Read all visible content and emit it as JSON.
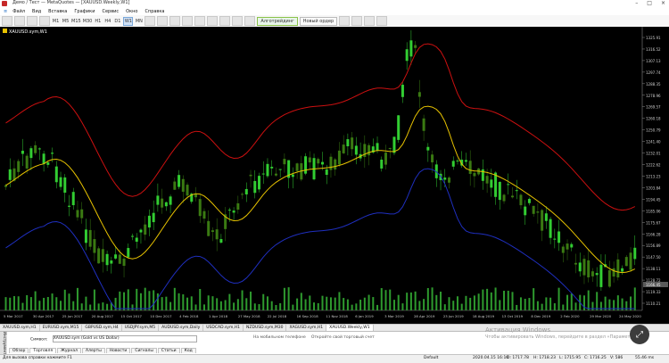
{
  "window": {
    "title": "Демо / Тест — MetaQuotes — [XAUUSD.Weekly,W1]"
  },
  "menu": {
    "items": [
      "Файл",
      "Вид",
      "Вставка",
      "Графики",
      "Сервис",
      "Окно",
      "Справка"
    ]
  },
  "toolbar": {
    "timeframes": [
      "M1",
      "M5",
      "M15",
      "M30",
      "H1",
      "H4",
      "D1",
      "W1",
      "MN"
    ],
    "active_timeframe": "W1",
    "algo_label": "Алготрейдинг",
    "new_order_label": "Новый ордер"
  },
  "chart": {
    "symbol_label": "XAUUSD.sym,W1",
    "price_labels": [
      "1325.91",
      "1316.52",
      "1307.13",
      "1297.74",
      "1288.35",
      "1278.96",
      "1269.57",
      "1260.18",
      "1250.79",
      "1241.40",
      "1232.01",
      "1222.62",
      "1213.23",
      "1203.84",
      "1194.45",
      "1185.06",
      "1175.67",
      "1166.28",
      "1156.89",
      "1147.50",
      "1138.11",
      "1128.72",
      "1119.33",
      "1110.21"
    ],
    "current_price": "1166.45",
    "time_labels": [
      "5 Mar 2017",
      "30 Apr 2017",
      "25 Jun 2017",
      "20 Aug 2017",
      "15 Oct 2017",
      "10 Dec 2017",
      "4 Feb 2018",
      "1 Apr 2018",
      "27 May 2018",
      "22 Jul 2018",
      "16 Sep 2018",
      "11 Nov 2018",
      "6 Jan 2019",
      "3 Mar 2019",
      "28 Apr 2019",
      "23 Jun 2019",
      "18 Aug 2019",
      "13 Oct 2019",
      "8 Dec 2019",
      "2 Feb 2020",
      "29 Mar 2020",
      "24 May 2020"
    ],
    "colors": {
      "background": "#000000",
      "bull": "#32cd32",
      "bear": "#3a7a12",
      "upper_band": "#cc1010",
      "middle_band": "#e8c300",
      "lower_band": "#1f2fbf",
      "volume": "#2e9a2e"
    }
  },
  "chart_tabs": [
    "XAUUSD.sym,H1",
    "EURUSD.sym,M15",
    "GBPUSD.sym,H4",
    "USDJPY.sym,M5",
    "AUDUSD.sym,Daily",
    "USDCAD.sym,H1",
    "NZDUSD.sym,M30",
    "XAGUSD.sym,H1",
    "XAUUSD.Weekly,W1"
  ],
  "active_chart_tab": "XAUUSD.Weekly,W1",
  "toolbox": {
    "side_label": "Инструменты",
    "symbol_label": "Символ:",
    "symbol_value": "XAUUSD.sym (Gold vs US Dollar)",
    "banner_a": "На мобильном телефоне",
    "banner_b": "Откройте свой торговый счет",
    "tabs": [
      "Обзор",
      "Торговля",
      "Журнал",
      "Алерты",
      "Новости",
      "Сигналы",
      "Статьи",
      "Код"
    ],
    "active_tab": "Торговля"
  },
  "watermark": {
    "line1": "Активация Windows",
    "line2": "Чтобы активировать Windows, перейдите в раздел «Параметры»."
  },
  "status": {
    "help": "Для вызова справки нажмите F1",
    "profile": "Default",
    "time": "2020.04.15 16:10",
    "open": "O: 1717.78",
    "high": "H: 1718.23",
    "low": "L: 1715.95",
    "close": "C: 1716.25",
    "volume": "V: 586",
    "ping": "55.46 ms"
  }
}
